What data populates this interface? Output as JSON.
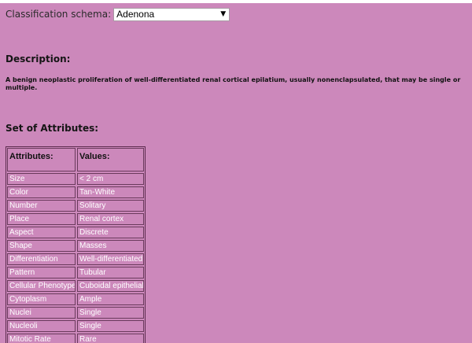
{
  "schema": {
    "label": "Classification schema:",
    "selected": "Adenona"
  },
  "description": {
    "heading": "Description:",
    "text": "A benign neoplastic proliferation of well-differentiated renal cortical epilatium, usually nonenclapsulated, that may be single or multiple."
  },
  "attributes": {
    "heading": "Set of Attributes:",
    "col_attr": "Attributes:",
    "col_val": "Values:",
    "rows": [
      {
        "attr": "Size",
        "value": "< 2 cm"
      },
      {
        "attr": "Color",
        "value": "Tan-White"
      },
      {
        "attr": "Number",
        "value": "Solitary"
      },
      {
        "attr": "Place",
        "value": "Renal cortex"
      },
      {
        "attr": "Aspect",
        "value": "Discrete"
      },
      {
        "attr": "Shape",
        "value": "Masses"
      },
      {
        "attr": "Differentiation",
        "value": "Well-differentiated"
      },
      {
        "attr": "Pattern",
        "value": "Tubular"
      },
      {
        "attr": "Cellular Phenotype",
        "value": "Cuboidal epithelial"
      },
      {
        "attr": "Cytoplasm",
        "value": "Ample"
      },
      {
        "attr": "Nuclei",
        "value": "Single"
      },
      {
        "attr": "Nucleoli",
        "value": "Single"
      },
      {
        "attr": "Mitotic Rate",
        "value": "Rare"
      }
    ]
  }
}
